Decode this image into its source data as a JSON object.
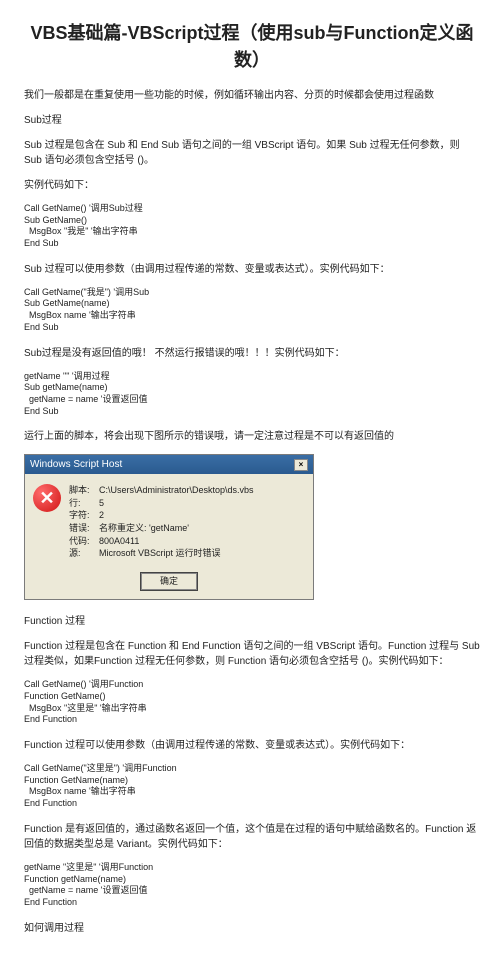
{
  "title": "VBS基础篇-VBScript过程（使用sub与Function定义函数）",
  "intro": "我们一般都是在重复使用一些功能的时候，例如循环输出内容、分页的时候都会使用过程函数",
  "s1": "Sub过程",
  "s1p1": "Sub 过程是包含在 Sub 和 End Sub 语句之间的一组 VBScript 语句。如果 Sub 过程无任何参数，则 Sub 语句必须包含空括号 ()。",
  "s1p2": "实例代码如下：",
  "code1": "Call GetName() '调用Sub过程\nSub GetName()\n  MsgBox \"我是\" '输出字符串\nEnd Sub",
  "s1p3": "Sub 过程可以使用参数（由调用过程传递的常数、变量或表达式）。实例代码如下：",
  "code2": "Call GetName(\"我是\") '调用Sub\nSub GetName(name)\n  MsgBox name '输出字符串\nEnd Sub",
  "s1p4": "Sub过程是没有返回值的哦！ 不然运行报错误的哦！！！实例代码如下：",
  "code3": "getName \"\" '调用过程\nSub getName(name)\n  getName = name '设置返回值\nEnd Sub",
  "s1p5": "运行上面的脚本，将会出现下图所示的错误哦，请一定注意过程是不可以有返回值的",
  "dialog": {
    "title": "Windows Script Host",
    "labels": {
      "script": "脚本:",
      "line": "行:",
      "char": "字符:",
      "error": "错误:",
      "code": "代码:",
      "source": "源:"
    },
    "values": {
      "script": "C:\\Users\\Administrator\\Desktop\\ds.vbs",
      "line": "5",
      "char": "2",
      "error": "名称重定义: 'getName'",
      "code": "800A0411",
      "source": "Microsoft VBScript 运行时错误"
    },
    "ok": "确定"
  },
  "s2": "Function 过程",
  "s2p1": "Function 过程是包含在 Function 和 End Function 语句之间的一组 VBScript 语句。Function 过程与 Sub 过程类似，如果Function 过程无任何参数，则 Function 语句必须包含空括号 ()。实例代码如下：",
  "code4": "Call GetName() '调用Function\nFunction GetName()\n  MsgBox \"这里是\" '输出字符串\nEnd Function",
  "s2p2": "Function 过程可以使用参数（由调用过程传递的常数、变量或表达式）。实例代码如下：",
  "code5": "Call GetName(\"这里是\") '调用Function\nFunction GetName(name)\n  MsgBox name '输出字符串\nEnd Function",
  "s2p3": "Function 是有返回值的，通过函数名返回一个值，这个值是在过程的语句中赋给函数名的。Function 返回值的数据类型总是 Variant。实例代码如下：",
  "code6": "getName \"这里是\" '调用Function\nFunction getName(name)\n  getName = name '设置返回值\nEnd Function",
  "s3": "如何调用过程"
}
